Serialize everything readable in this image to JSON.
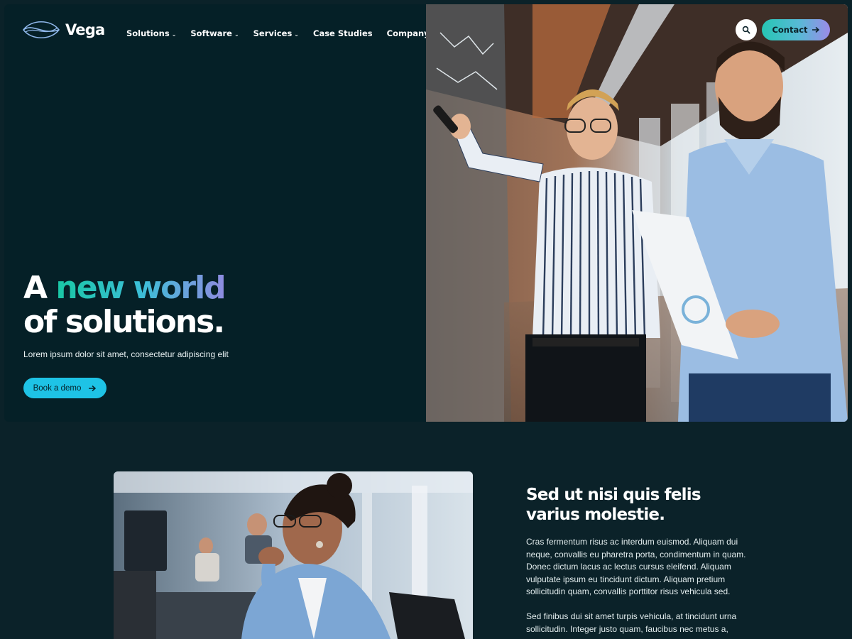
{
  "brand": {
    "name": "Vega"
  },
  "nav": {
    "items": [
      {
        "label": "Solutions",
        "has_dropdown": true
      },
      {
        "label": "Software",
        "has_dropdown": true
      },
      {
        "label": "Services",
        "has_dropdown": true
      },
      {
        "label": "Case Studies",
        "has_dropdown": false
      },
      {
        "label": "Company",
        "has_dropdown": true
      }
    ],
    "search_icon": "search-icon",
    "contact_label": "Contact"
  },
  "hero": {
    "headline_start": "A",
    "headline_highlight": "new world",
    "headline_end": "of solutions.",
    "subtitle": "Lorem ipsum dolor sit amet, consectetur adipiscing elit",
    "cta_label": "Book a demo",
    "image_subject": "two-men-at-glass-whiteboard"
  },
  "section": {
    "title": "Sed ut nisi quis felis varius molestie.",
    "paragraph_1": "Cras fermentum risus ac interdum euismod. Aliquam dui neque, convallis eu pharetra porta, condimentum in quam. Donec dictum lacus ac lectus cursus eleifend. Aliquam vulputate ipsum eu tincidunt dictum. Aliquam pretium sollicitudin quam, convallis porttitor risus vehicula sed.",
    "paragraph_2": "Sed finibus dui sit amet turpis vehicula, at tincidunt urna sollicitudin. Integer justo quam, faucibus nec metus a,",
    "image_subject": "woman-thinking-in-office"
  },
  "colors": {
    "background": "#0b2229",
    "hero_background": "#052027",
    "accent_teal": "#19c7a4",
    "accent_cyan": "#1ec3e6",
    "accent_violet": "#8f8be0"
  }
}
